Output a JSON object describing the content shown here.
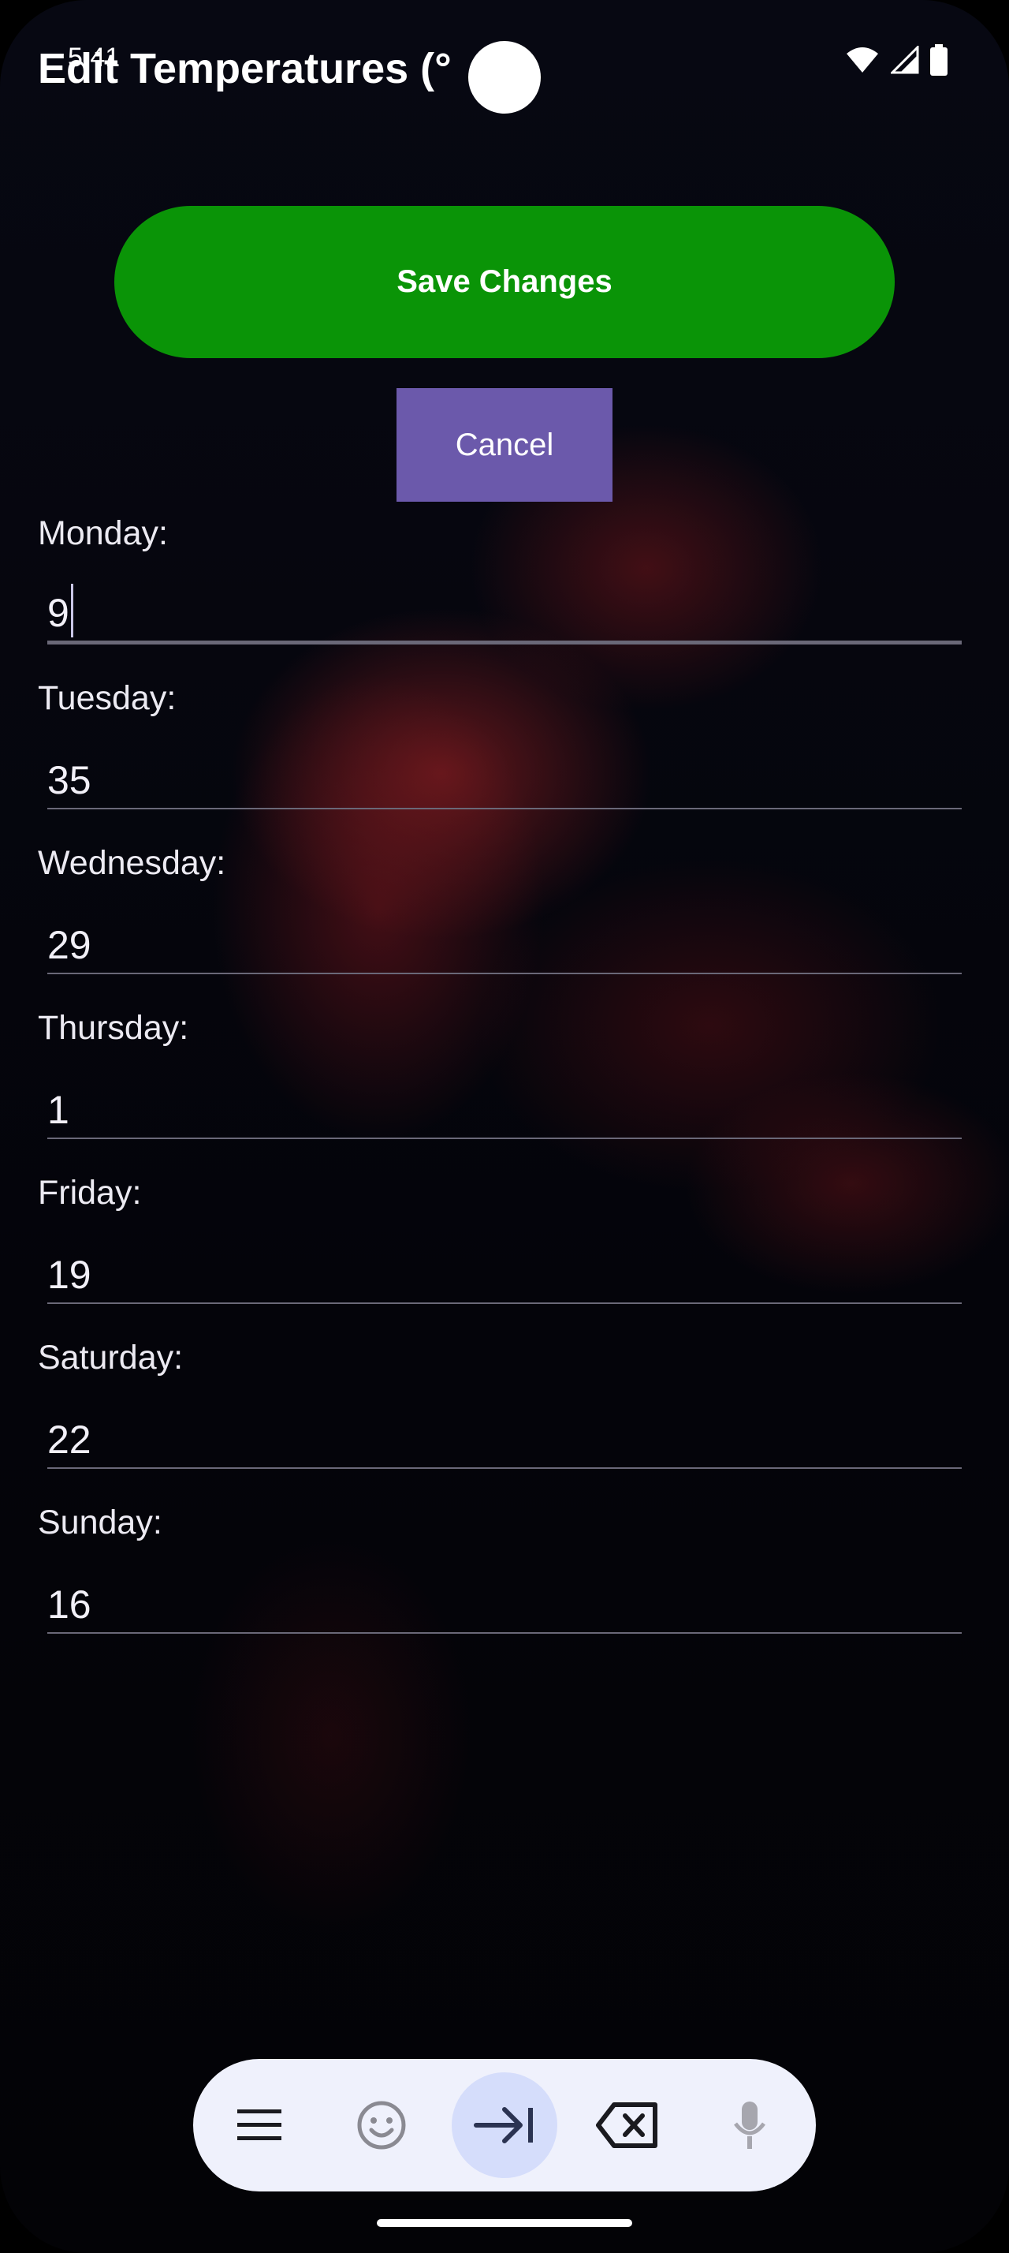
{
  "status_bar": {
    "time": "5:41",
    "icons": [
      "sync-icon",
      "sd-card-icon",
      "wifi-icon",
      "signal-icon",
      "battery-icon"
    ]
  },
  "header": {
    "title": "Edit Temperatures (°"
  },
  "actions": {
    "save_label": "Save Changes",
    "cancel_label": "Cancel"
  },
  "days": [
    {
      "label": "Monday:",
      "value": "9"
    },
    {
      "label": "Tuesday:",
      "value": "35"
    },
    {
      "label": "Wednesday:",
      "value": "29"
    },
    {
      "label": "Thursday:",
      "value": "1"
    },
    {
      "label": "Friday:",
      "value": "19"
    },
    {
      "label": "Saturday:",
      "value": "22"
    },
    {
      "label": "Sunday:",
      "value": "16"
    }
  ],
  "keyboard_toolbar": {
    "keys": [
      "menu-icon",
      "emoji-icon",
      "tab-next-icon",
      "backspace-icon",
      "microphone-icon"
    ],
    "active_key": "tab-next-icon"
  },
  "colors": {
    "save_button": "#0a9407",
    "cancel_button": "#6b59ab",
    "toolbar_background": "#eff1fc",
    "active_key_highlight": "#d5ddfb"
  }
}
